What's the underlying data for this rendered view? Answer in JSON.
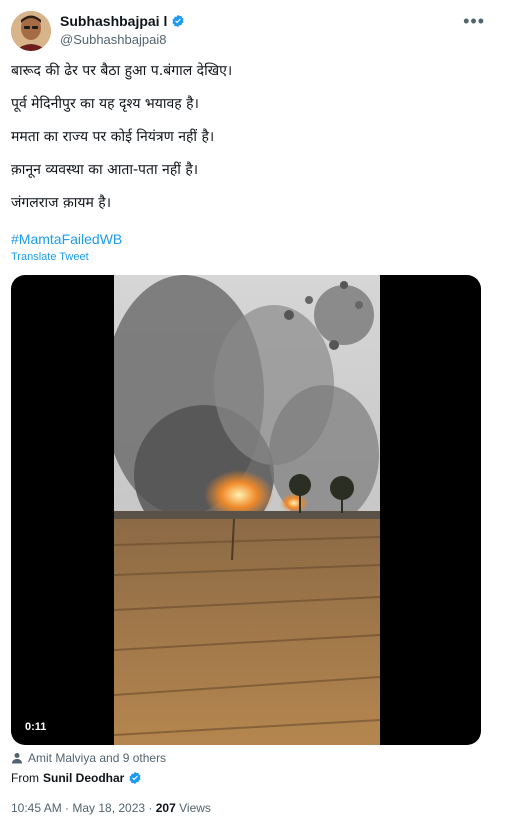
{
  "author": {
    "display_name": "Subhashbajpai l",
    "handle": "@Subhashbajpai8"
  },
  "menu_icon": "more-horizontal-icon",
  "tweet_lines": [
    "बारूद की ढेर पर बैठा हुआ प.बंगाल देखिए।",
    "पूर्व मेदिनीपुर का यह दृश्य भयावह है।",
    "ममता का राज्य पर कोई नियंत्रण नहीं है।",
    "क़ानून व्यवस्था का आता-पता नहीं है।",
    "जंगलराज क़ायम है।"
  ],
  "hashtag": "#MamtaFailedWB",
  "translate_label": "Translate Tweet",
  "media": {
    "duration": "0:11"
  },
  "social_context": {
    "text": "Amit Malviya and 9 others",
    "icon": "person-icon"
  },
  "retweet_from": {
    "prefix": "From",
    "name": "Sunil Deodhar"
  },
  "meta": {
    "timestamp": "10:45 AM · May 18, 2023 · ",
    "views_count": "207",
    "views_label": " Views"
  },
  "colors": {
    "link": "#1d9bf0",
    "verified": "#1d9bf0",
    "muted": "#536471"
  }
}
